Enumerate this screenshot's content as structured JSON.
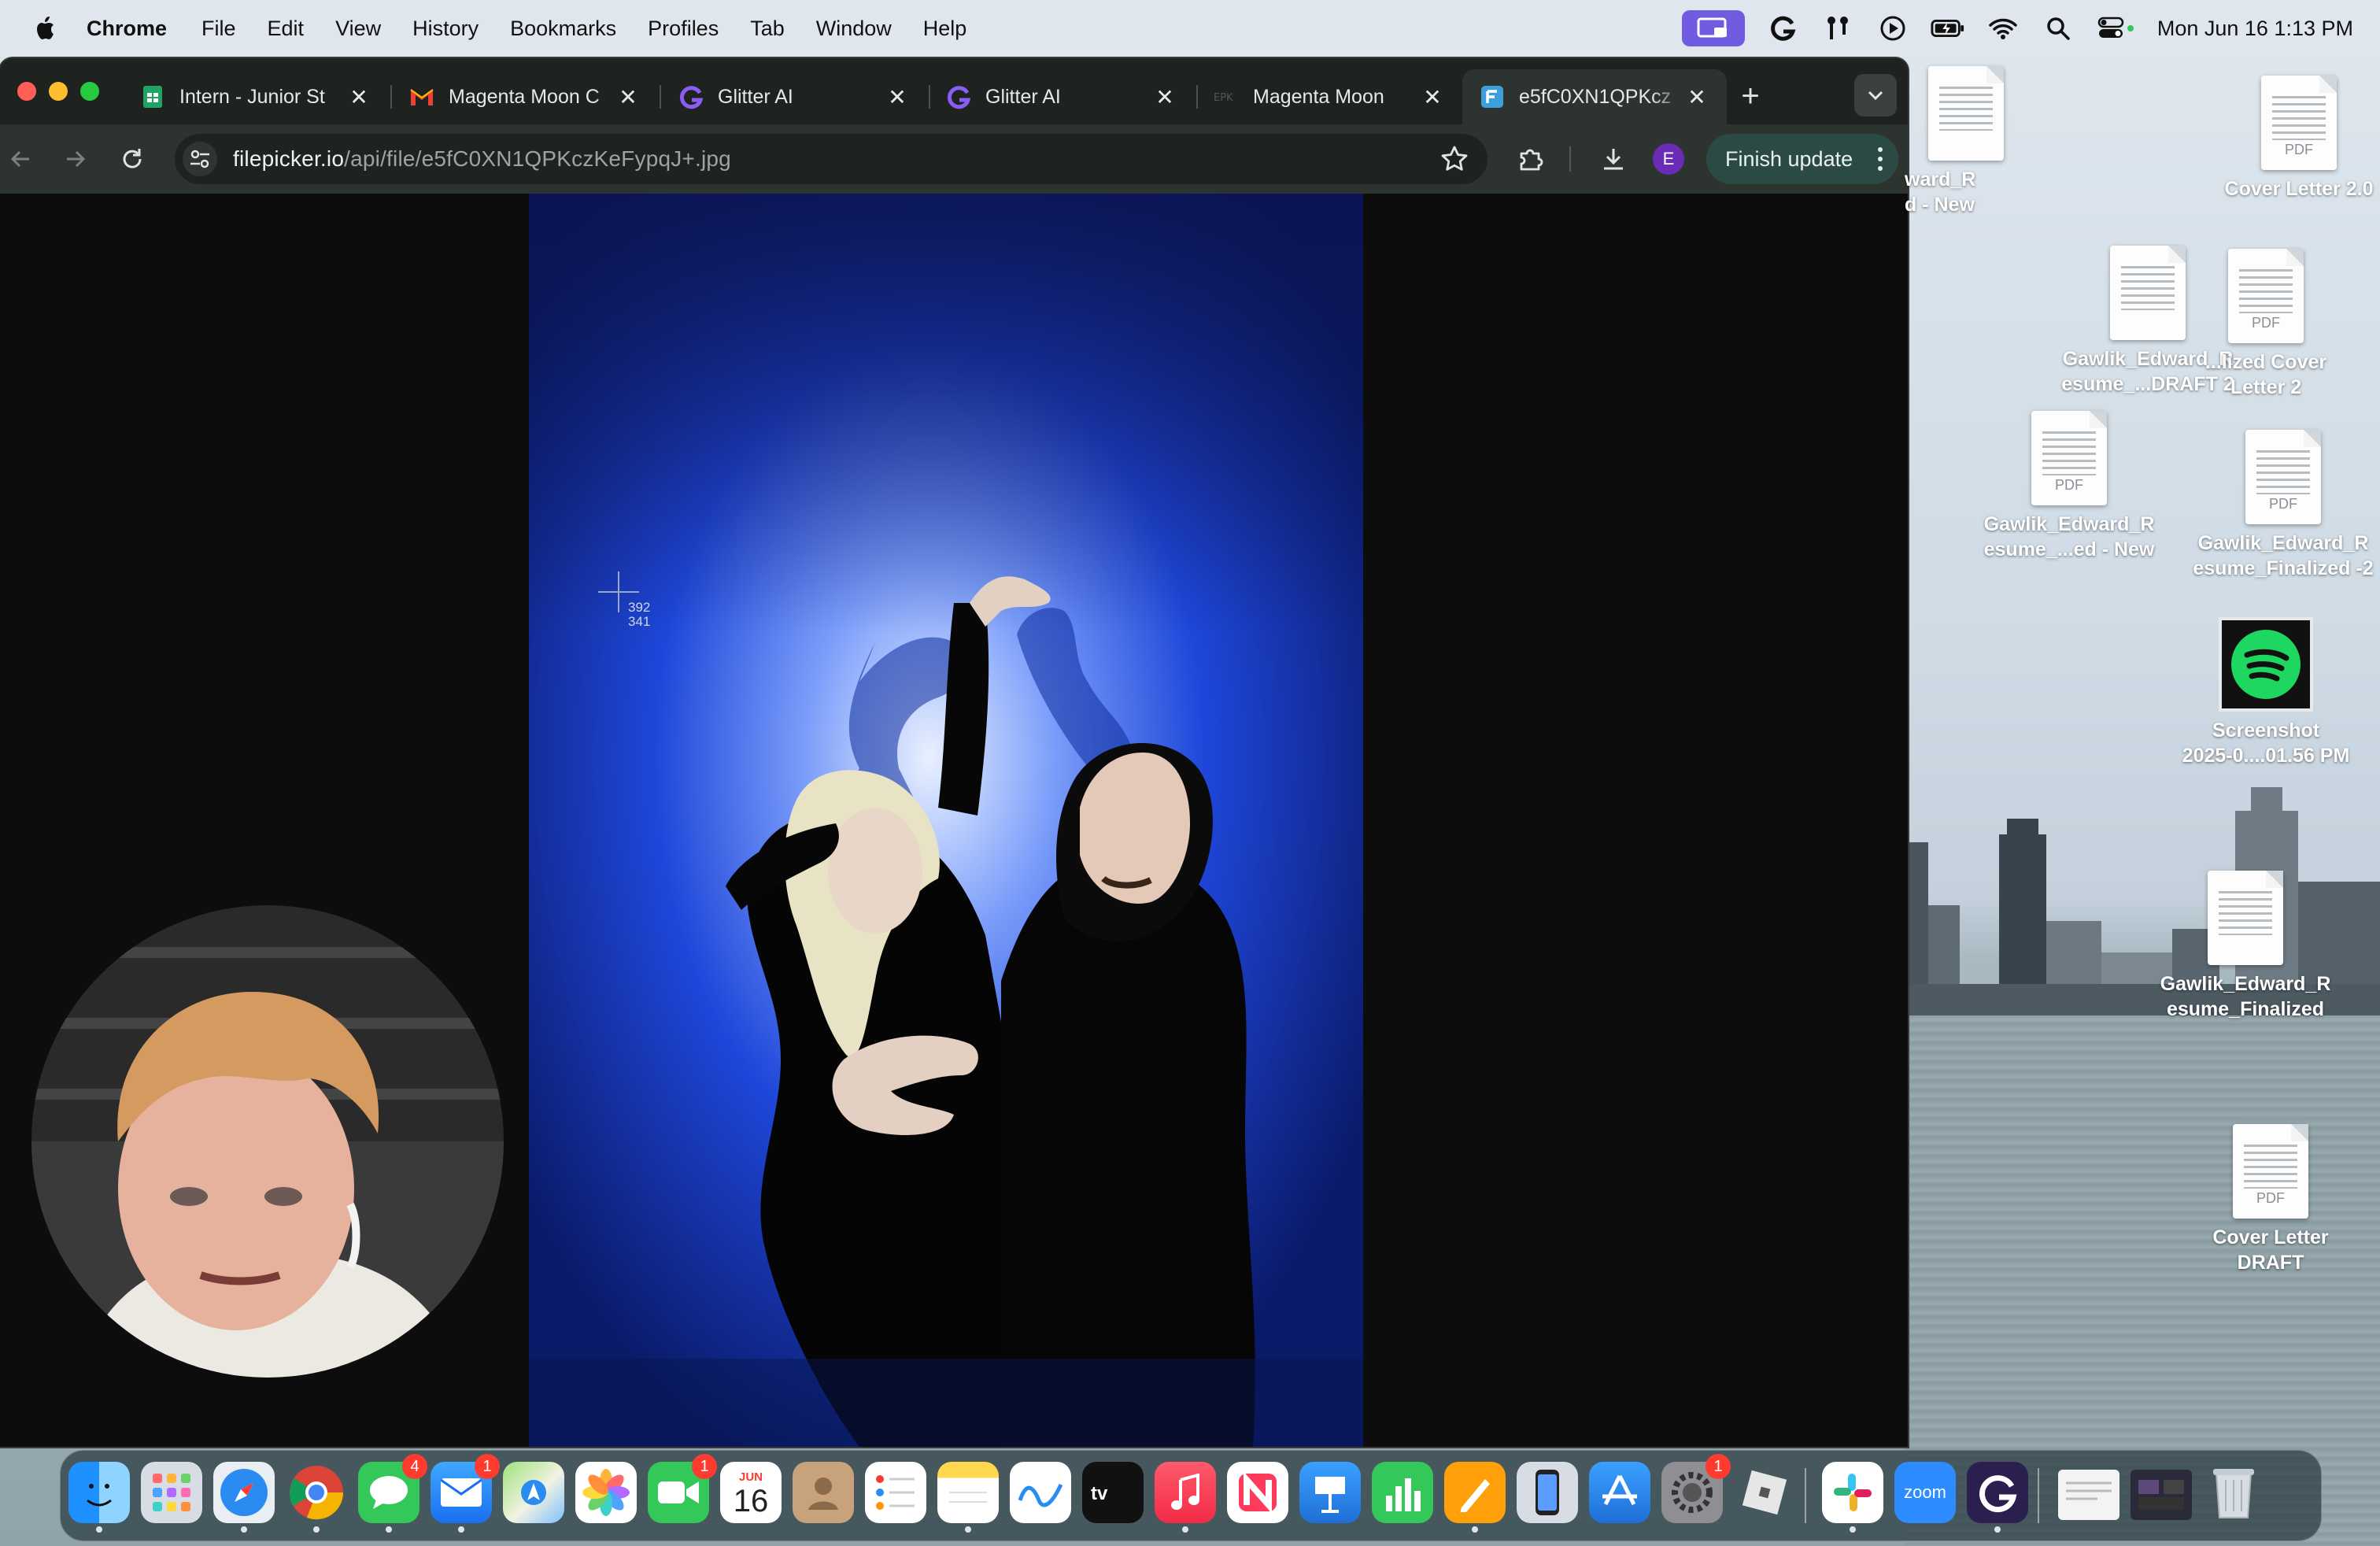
{
  "menubar": {
    "app": "Chrome",
    "items": [
      "File",
      "Edit",
      "View",
      "History",
      "Bookmarks",
      "Profiles",
      "Tab",
      "Window",
      "Help"
    ],
    "clock": "Mon Jun 16  1:13 PM"
  },
  "tabs": [
    {
      "label": "Intern - Junior St",
      "icon": "sheets-icon"
    },
    {
      "label": "Magenta Moon C",
      "icon": "gmail-icon"
    },
    {
      "label": "Glitter AI",
      "icon": "glitter-icon"
    },
    {
      "label": "Glitter AI",
      "icon": "glitter-icon"
    },
    {
      "label": "Magenta Moon",
      "icon": "epk-icon"
    },
    {
      "label": "e5fC0XN1QPKcz",
      "icon": "filepicker-icon"
    }
  ],
  "toolbar": {
    "url_host": "filepicker.io",
    "url_path": "/api/file/e5fC0XN1QPKczKeFypqJ+.jpg",
    "profile_initial": "E",
    "finish_update": "Finish update"
  },
  "cursor": {
    "x_readout": "392",
    "y_readout": "341"
  },
  "desktop_icons": [
    {
      "label": "ward_R\nd - New"
    },
    {
      "label": "Cover Letter 2.0",
      "kind": "PDF"
    },
    {
      "label": "Gawlik_Edward_R\nesume_...DRAFT 2"
    },
    {
      "label": "...lized Cover\nLetter 2",
      "kind": "PDF"
    },
    {
      "label": "Gawlik_Edward_R\nesume_...ed - New",
      "kind": "PDF"
    },
    {
      "label": "Gawlik_Edward_R\nesume_Finalized -2",
      "kind": "PDF"
    },
    {
      "label": "Screenshot\n2025-0....01.56 PM"
    },
    {
      "label": "Gawlik_Edward_R\nesume_Finalized"
    },
    {
      "label": "Cover Letter\nDRAFT",
      "kind": "PDF"
    }
  ],
  "dock": {
    "calendar_month": "JUN",
    "calendar_day": "16",
    "badges": {
      "messages": "4",
      "mail": "1",
      "facetime": "1",
      "settings": "1"
    },
    "zoom_label": "zoom"
  }
}
